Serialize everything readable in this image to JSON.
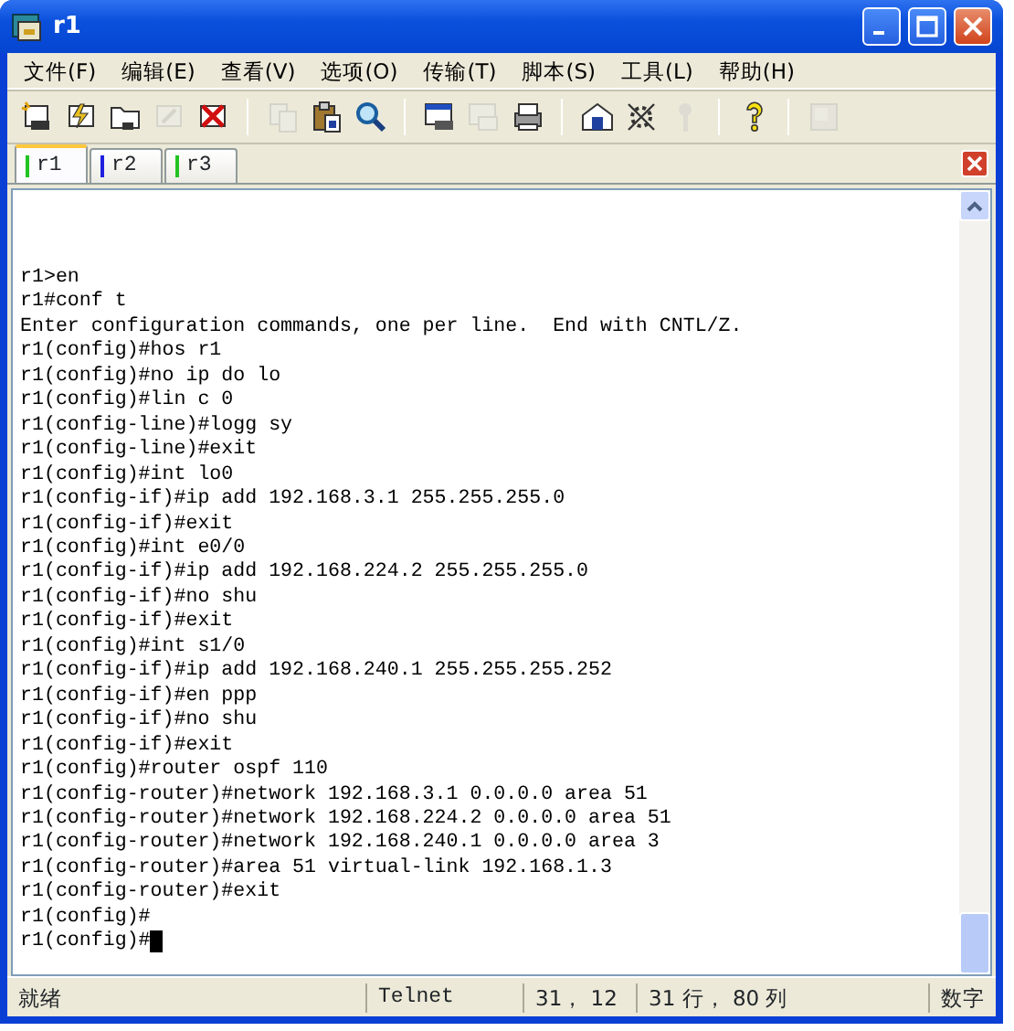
{
  "window": {
    "title": "r1"
  },
  "menu": [
    {
      "label": "文件(F)"
    },
    {
      "label": "编辑(E)"
    },
    {
      "label": "查看(V)"
    },
    {
      "label": "选项(O)"
    },
    {
      "label": "传输(T)"
    },
    {
      "label": "脚本(S)"
    },
    {
      "label": "工具(L)"
    },
    {
      "label": "帮助(H)"
    }
  ],
  "toolbar": [
    [
      {
        "disabled": false
      },
      {
        "disabled": false
      },
      {
        "disabled": false
      },
      {
        "disabled": true
      },
      {
        "disabled": false
      }
    ],
    [
      {
        "disabled": true
      },
      {
        "disabled": false
      },
      {
        "disabled": false
      }
    ],
    [
      {
        "disabled": false
      },
      {
        "disabled": true
      },
      {
        "disabled": false
      }
    ],
    [
      {
        "disabled": false
      },
      {
        "disabled": false
      },
      {
        "disabled": true
      }
    ],
    [
      {
        "disabled": false
      }
    ],
    [
      {
        "disabled": true
      }
    ]
  ],
  "tabs": [
    {
      "label": "r1",
      "selected": true,
      "color": "#22c322"
    },
    {
      "label": "r2",
      "selected": false,
      "color": "#2020e0"
    },
    {
      "label": "r3",
      "selected": false,
      "color": "#22c322"
    }
  ],
  "terminal": {
    "lines": [
      "r1>en",
      "r1#conf t",
      "Enter configuration commands, one per line.  End with CNTL/Z.",
      "r1(config)#hos r1",
      "r1(config)#no ip do lo",
      "r1(config)#lin c 0",
      "r1(config-line)#logg sy",
      "r1(config-line)#exit",
      "r1(config)#int lo0",
      "r1(config-if)#ip add 192.168.3.1 255.255.255.0",
      "r1(config-if)#exit",
      "r1(config)#int e0/0",
      "r1(config-if)#ip add 192.168.224.2 255.255.255.0",
      "r1(config-if)#no shu",
      "r1(config-if)#exit",
      "r1(config)#int s1/0",
      "r1(config-if)#ip add 192.168.240.1 255.255.255.252",
      "r1(config-if)#en ppp",
      "r1(config-if)#no shu",
      "r1(config-if)#exit",
      "r1(config)#router ospf 110",
      "r1(config-router)#network 192.168.3.1 0.0.0.0 area 51",
      "r1(config-router)#network 192.168.224.2 0.0.0.0 area 51",
      "r1(config-router)#network 192.168.240.1 0.0.0.0 area 3",
      "r1(config-router)#area 51 virtual-link 192.168.1.3",
      "r1(config-router)#exit",
      "r1(config)#",
      "r1(config)#"
    ],
    "cursor": true
  },
  "status_bar": {
    "status": "就绪",
    "protocol": "Telnet",
    "position": "31， 12",
    "size": "31 行， 80 列",
    "num_lock": "数字"
  }
}
